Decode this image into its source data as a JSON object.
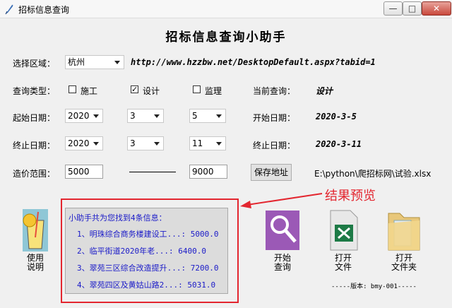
{
  "window": {
    "title": "招标信息查询",
    "minimize": "—",
    "maximize": "□",
    "close": "✕"
  },
  "heading": "招标信息查询小助手",
  "region": {
    "label": "选择区域：",
    "selected": "杭州",
    "url": "http://www.hzzbw.net/DesktopDefault.aspx?tabid=1"
  },
  "query_type": {
    "label": "查询类型：",
    "options": [
      {
        "label": "施工",
        "checked": false
      },
      {
        "label": "设计",
        "checked": true
      },
      {
        "label": "监理",
        "checked": false
      }
    ],
    "current_label": "当前查询：",
    "current_value": "设计"
  },
  "start_date": {
    "label": "起始日期：",
    "year": "2020",
    "month": "3",
    "day": "5",
    "display_label": "开始日期：",
    "display_value": "2020-3-5"
  },
  "end_date": {
    "label": "终止日期：",
    "year": "2020",
    "month": "3",
    "day": "11",
    "display_label": "终止日期：",
    "display_value": "2020-3-11"
  },
  "price_range": {
    "label": "造价范围：",
    "min": "5000",
    "max": "9000",
    "save_button": "保存地址",
    "save_path": "E:\\python\\爬招标网\\试验.xlsx"
  },
  "results": {
    "summary": "小助手共为您找到4条信息：",
    "items": [
      "1、明珠综合商务楼建设工...:  5000.0",
      "2、临平街道2020年老...:  6400.0",
      "3、翠苑三区综合改造提升...:  7200.0",
      "4、翠苑四区及黄姑山路2...:  5031.0"
    ]
  },
  "annotation": "结果预览",
  "buttons": {
    "manual": [
      "使用",
      "说明"
    ],
    "start_query": [
      "开始",
      "查询"
    ],
    "open_file": [
      "打开",
      "文件"
    ],
    "open_folder": [
      "打开",
      "文件夹"
    ]
  },
  "version": "-----版本: bmy-001-----",
  "colors": {
    "annotation_red": "#e3262f",
    "result_text": "#1a1ac8",
    "query_purple": "#9b59b6",
    "excel_green": "#1d7a46"
  }
}
